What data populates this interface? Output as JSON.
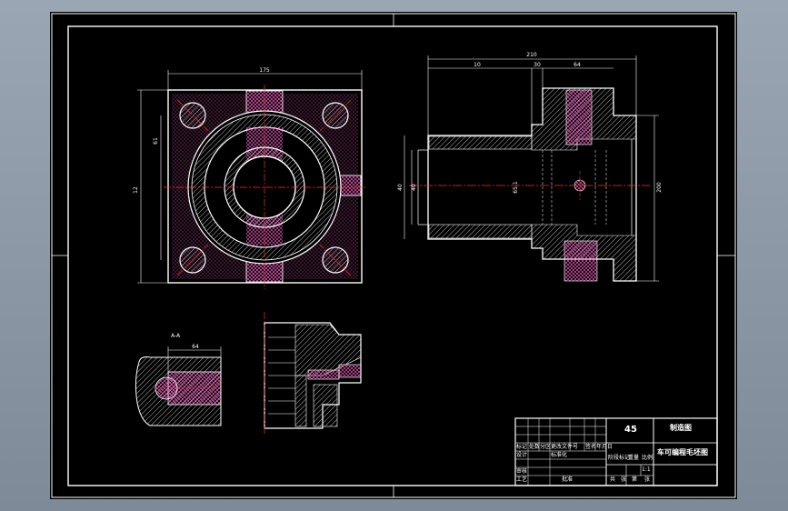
{
  "colors": {
    "background": "#8e9aa7",
    "sheet": "#000000",
    "line": "#ffffff",
    "centerline": "#ff2a2a",
    "hatch": "#ff66cc"
  },
  "drawing": {
    "front_view": {
      "width_dim": "175",
      "height_dim_outer": "12",
      "height_dim_inner": "61"
    },
    "side_view": {
      "overall_dim": "210",
      "dim_left": "10",
      "dim_mid": "30",
      "dim_right": "64",
      "dia_left": "40",
      "dia_mid_a": "40",
      "dia_mid_b": "65.1",
      "dia_right": "200"
    },
    "detail_view": {
      "label": "A-A",
      "dim": "64"
    }
  },
  "title_block": {
    "material": "45",
    "school": "制造图",
    "drawing_name": "车可编程毛坯图",
    "scale_label": "1:1",
    "left_cells": [
      "标记",
      "处数",
      "分区",
      "更改文件号",
      "签名",
      "年月日"
    ],
    "row_labels": [
      "设计",
      "审核",
      "工艺"
    ],
    "std_label": "标准化",
    "approve_label": "批准",
    "stage_label": "阶段标记",
    "weight_label": "重量",
    "scale_word": "比例",
    "sheet_labels": [
      "共",
      "张",
      "第",
      "张"
    ]
  }
}
